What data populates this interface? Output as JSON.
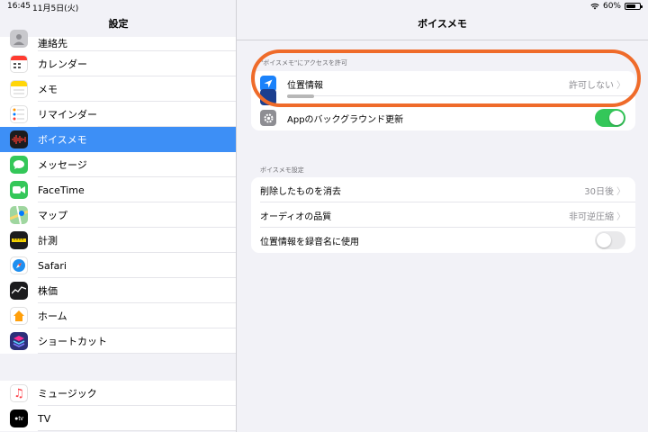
{
  "status": {
    "time": "16:45",
    "date": "11月5日(火)",
    "battery": "60%"
  },
  "sidebar": {
    "title": "設定",
    "items": [
      {
        "label": "連絡先",
        "icon": "contacts-icon",
        "color": "#c8c8cc"
      },
      {
        "label": "カレンダー",
        "icon": "calendar-icon",
        "color": "#ffffff"
      },
      {
        "label": "メモ",
        "icon": "notes-icon",
        "color": "#ffd60a"
      },
      {
        "label": "リマインダー",
        "icon": "reminders-icon",
        "color": "#ffffff"
      },
      {
        "label": "ボイスメモ",
        "icon": "voice-memos-icon",
        "color": "#1c1c1e",
        "selected": true
      },
      {
        "label": "メッセージ",
        "icon": "messages-icon",
        "color": "#34c759"
      },
      {
        "label": "FaceTime",
        "icon": "facetime-icon",
        "color": "#34c759"
      },
      {
        "label": "マップ",
        "icon": "maps-icon",
        "color": "#7fc97f"
      },
      {
        "label": "計測",
        "icon": "measure-icon",
        "color": "#1c1c1e"
      },
      {
        "label": "Safari",
        "icon": "safari-icon",
        "color": "#ffffff"
      },
      {
        "label": "株価",
        "icon": "stocks-icon",
        "color": "#1c1c1e"
      },
      {
        "label": "ホーム",
        "icon": "home-icon",
        "color": "#ffffff"
      },
      {
        "label": "ショートカット",
        "icon": "shortcuts-icon",
        "color": "#2c2f7a"
      }
    ],
    "items2": [
      {
        "label": "ミュージック",
        "icon": "music-icon",
        "color": "#ffffff"
      },
      {
        "label": "TV",
        "icon": "tv-icon",
        "color": "#000000"
      }
    ]
  },
  "detail": {
    "title": "ボイスメモ",
    "access_header": "\"ボイスメモ\"にアクセスを許可",
    "location": {
      "label": "位置情報",
      "value": "許可しない",
      "icon": "location-arrow-icon",
      "color": "#1a82fb"
    },
    "background_refresh": {
      "label": "Appのバックグラウンド更新",
      "icon": "gear-icon",
      "on": true
    },
    "settings_header": "ボイスメモ設定",
    "clear_deleted": {
      "label": "削除したものを消去",
      "value": "30日後"
    },
    "audio_quality": {
      "label": "オーディオの品質",
      "value": "非可逆圧縮"
    },
    "location_naming": {
      "label": "位置情報を録音名に使用",
      "on": false
    }
  },
  "accent_colors": {
    "selected": "#3d8ff6",
    "toggle_on": "#34c759",
    "highlight": "#ef6b2a"
  }
}
